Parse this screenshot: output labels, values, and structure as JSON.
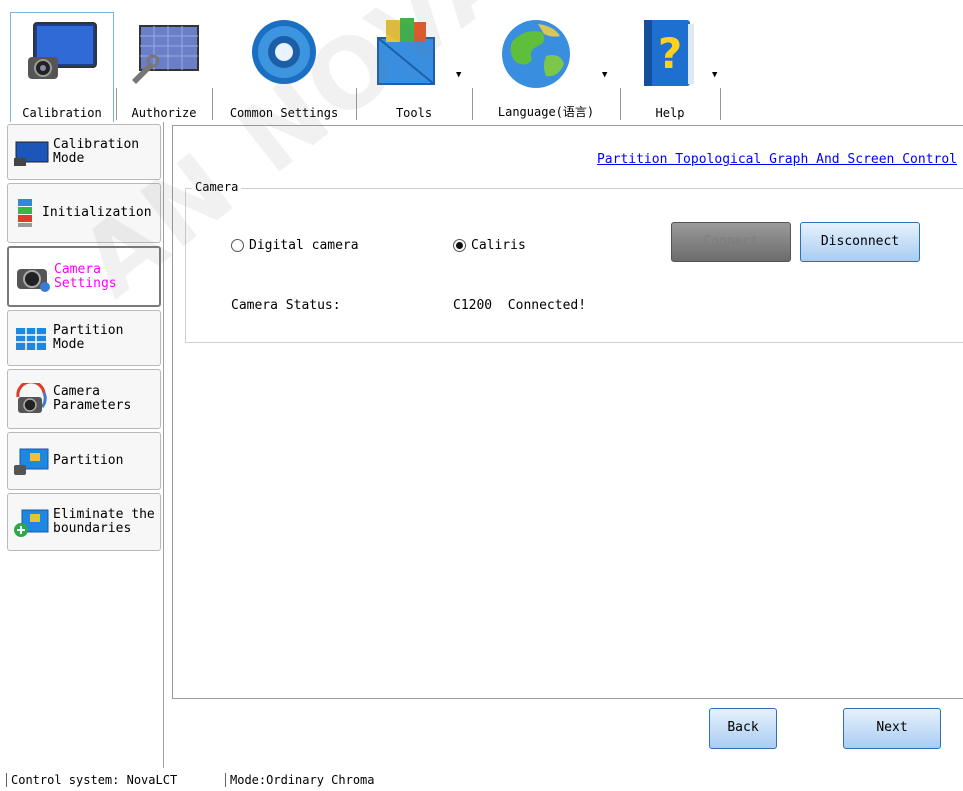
{
  "toolbar": {
    "items": [
      {
        "label": "Calibration",
        "icon": "monitor-camera-icon",
        "active": true
      },
      {
        "label": "Authorize",
        "icon": "screen-wrench-icon"
      },
      {
        "label": "Common Settings",
        "icon": "gear-icon"
      },
      {
        "label": "Tools",
        "icon": "toolbox-icon",
        "dropdown": true
      },
      {
        "label": "Language(语言)",
        "icon": "globe-icon",
        "dropdown": true
      },
      {
        "label": "Help",
        "icon": "help-book-icon",
        "dropdown": true
      }
    ]
  },
  "sidebar": {
    "items": [
      {
        "label": "Calibration\nMode",
        "icon": "calibration-mode-icon"
      },
      {
        "label": "Initialization",
        "icon": "initialization-icon"
      },
      {
        "label": "Camera\nSettings",
        "icon": "camera-settings-icon",
        "active": true
      },
      {
        "label": "Partition\nMode",
        "icon": "partition-mode-icon"
      },
      {
        "label": "Camera\nParameters",
        "icon": "camera-parameters-icon"
      },
      {
        "label": "Partition",
        "icon": "partition-icon"
      },
      {
        "label": "Eliminate the\nboundaries",
        "icon": "eliminate-boundaries-icon"
      }
    ]
  },
  "main": {
    "topology_link": "Partition Topological Graph And Screen Control",
    "camera_group": {
      "title": "Camera",
      "options": [
        {
          "label": "Digital camera",
          "selected": false
        },
        {
          "label": "Caliris",
          "selected": true
        }
      ],
      "connect_label": "Connect",
      "disconnect_label": "Disconnect",
      "status_label": "Camera Status:",
      "status_value": "C1200  Connected!"
    },
    "back_label": "Back",
    "next_label": "Next"
  },
  "statusbar": {
    "control_system": "Control system: NovaLCT",
    "mode": "Mode:Ordinary Chroma"
  },
  "watermark": "AN NOVASTAR",
  "colors": {
    "accent_border": "#7fb1dd",
    "link": "#0000ff",
    "active_sidebar_text": "#ff00ff",
    "button_blue": "#a9cdf2"
  }
}
